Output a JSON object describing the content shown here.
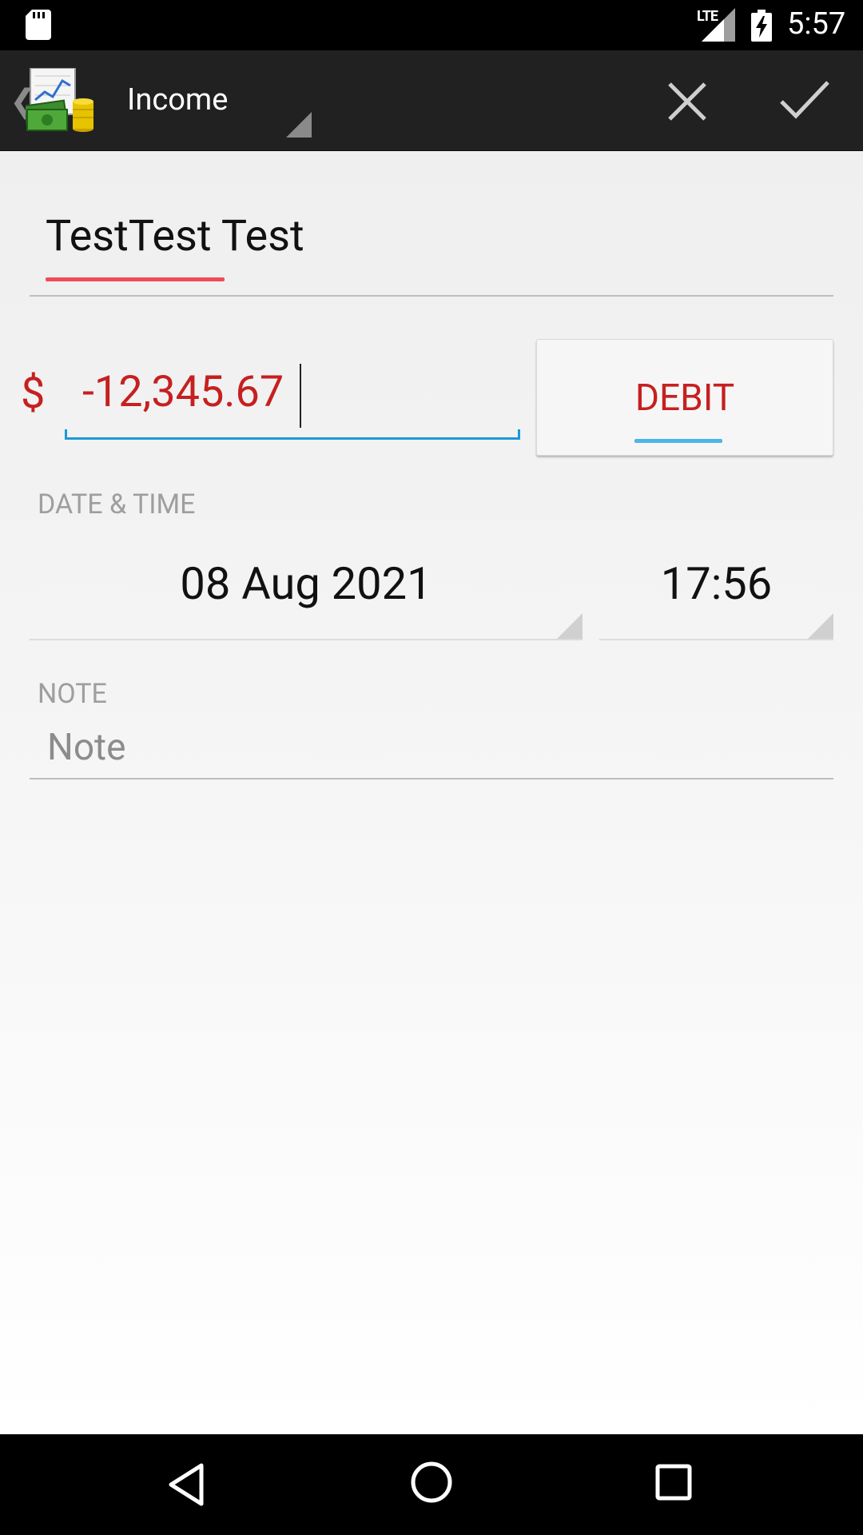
{
  "status_bar": {
    "network": "LTE",
    "time": "5:57"
  },
  "action_bar": {
    "title": "Income",
    "icons": {
      "up": "chevron-left-icon",
      "app": "app-chart-money-icon",
      "cancel": "close-icon",
      "confirm": "check-icon"
    }
  },
  "form": {
    "payee": "TestTest Test",
    "currency_symbol": "$",
    "amount": "-12,345.67",
    "type_button": "DEBIT",
    "date_time_label": "DATE & TIME",
    "date": "08 Aug 2021",
    "time": "17:56",
    "note_label": "NOTE",
    "note_value": "",
    "note_placeholder": "Note"
  },
  "colors": {
    "accent_blue": "#1a9ad7",
    "debit_red": "#c62020",
    "spellcheck_red": "#f04b5b",
    "action_bar_bg": "#212121"
  }
}
